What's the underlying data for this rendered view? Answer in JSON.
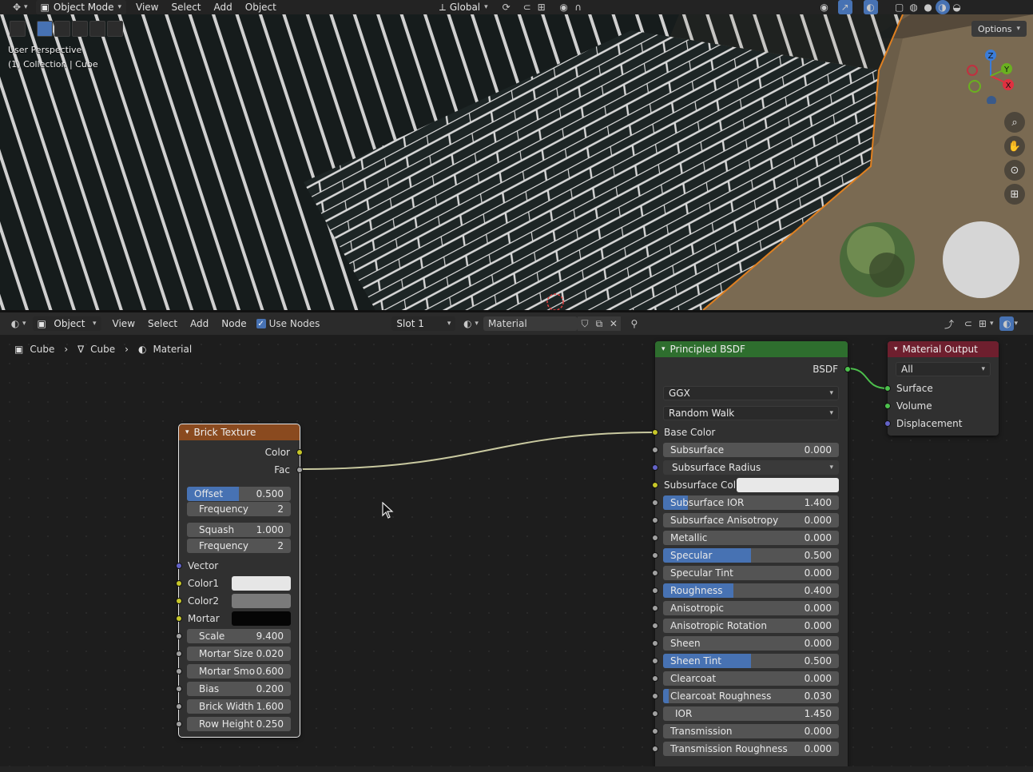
{
  "topbar": {
    "mode": "Object Mode",
    "menus": [
      "View",
      "Select",
      "Add",
      "Object"
    ],
    "orientation": "Global"
  },
  "viewport": {
    "perspective": "User Perspective",
    "collection": "(1) Collection | Cube",
    "options_label": "Options",
    "gizmo": {
      "z": "Z",
      "y": "Y",
      "x": "X"
    }
  },
  "node_header": {
    "mode": "Object",
    "menus": [
      "View",
      "Select",
      "Add",
      "Node"
    ],
    "use_nodes_label": "Use Nodes",
    "use_nodes_checked": true,
    "slot": "Slot 1",
    "material": "Material"
  },
  "breadcrumb": {
    "object": "Cube",
    "mesh": "Cube",
    "material": "Material"
  },
  "brick": {
    "title": "Brick Texture",
    "outputs": {
      "color": "Color",
      "fac": "Fac"
    },
    "offset": {
      "label": "Offset",
      "value": "0.500",
      "fill": 0.5
    },
    "frequency1": {
      "label": "Frequency",
      "value": "2"
    },
    "squash": {
      "label": "Squash",
      "value": "1.000"
    },
    "frequency2": {
      "label": "Frequency",
      "value": "2"
    },
    "vector": "Vector",
    "color1": {
      "label": "Color1",
      "swatch": "#e6e6e6"
    },
    "color2": {
      "label": "Color2",
      "swatch": "#7a7a7a"
    },
    "mortar": {
      "label": "Mortar",
      "swatch": "#050505"
    },
    "fields": [
      {
        "label": "Scale",
        "value": "9.400"
      },
      {
        "label": "Mortar Size",
        "value": "0.020"
      },
      {
        "label": "Mortar Smo",
        "value": "0.600"
      },
      {
        "label": "Bias",
        "value": "0.200"
      },
      {
        "label": "Brick Width",
        "value": "1.600"
      },
      {
        "label": "Row Height",
        "value": "0.250"
      }
    ]
  },
  "bsdf": {
    "title": "Principled BSDF",
    "output": "BSDF",
    "distribution": "GGX",
    "subsurface_method": "Random Walk",
    "base_color": "Base Color",
    "subsurface": {
      "label": "Subsurface",
      "value": "0.000"
    },
    "subsurface_radius": "Subsurface Radius",
    "subsurface_color": {
      "label": "Subsurface Col...",
      "swatch": "#e8e8e8"
    },
    "fields": [
      {
        "label": "Subsurface IOR",
        "value": "1.400",
        "fill": 0.14
      },
      {
        "label": "Subsurface Anisotropy",
        "value": "0.000",
        "fill": 0
      },
      {
        "label": "Metallic",
        "value": "0.000",
        "fill": 0
      },
      {
        "label": "Specular",
        "value": "0.500",
        "fill": 0.5
      },
      {
        "label": "Specular Tint",
        "value": "0.000",
        "fill": 0
      },
      {
        "label": "Roughness",
        "value": "0.400",
        "fill": 0.4
      },
      {
        "label": "Anisotropic",
        "value": "0.000",
        "fill": 0
      },
      {
        "label": "Anisotropic Rotation",
        "value": "0.000",
        "fill": 0
      },
      {
        "label": "Sheen",
        "value": "0.000",
        "fill": 0
      },
      {
        "label": "Sheen Tint",
        "value": "0.500",
        "fill": 0.5
      },
      {
        "label": "Clearcoat",
        "value": "0.000",
        "fill": 0
      },
      {
        "label": "Clearcoat Roughness",
        "value": "0.030",
        "fill": 0.03
      },
      {
        "label": "IOR",
        "value": "1.450",
        "fill": 0
      },
      {
        "label": "Transmission",
        "value": "0.000",
        "fill": 0
      },
      {
        "label": "Transmission Roughness",
        "value": "0.000",
        "fill": 0
      }
    ]
  },
  "output_node": {
    "title": "Material Output",
    "target": "All",
    "inputs": [
      "Surface",
      "Volume",
      "Displacement"
    ]
  },
  "colors": {
    "texture_header": "#8a4a1f",
    "shader_header": "#2e6e2e",
    "output_header": "#6e1f2e",
    "accent": "#4772b3"
  }
}
